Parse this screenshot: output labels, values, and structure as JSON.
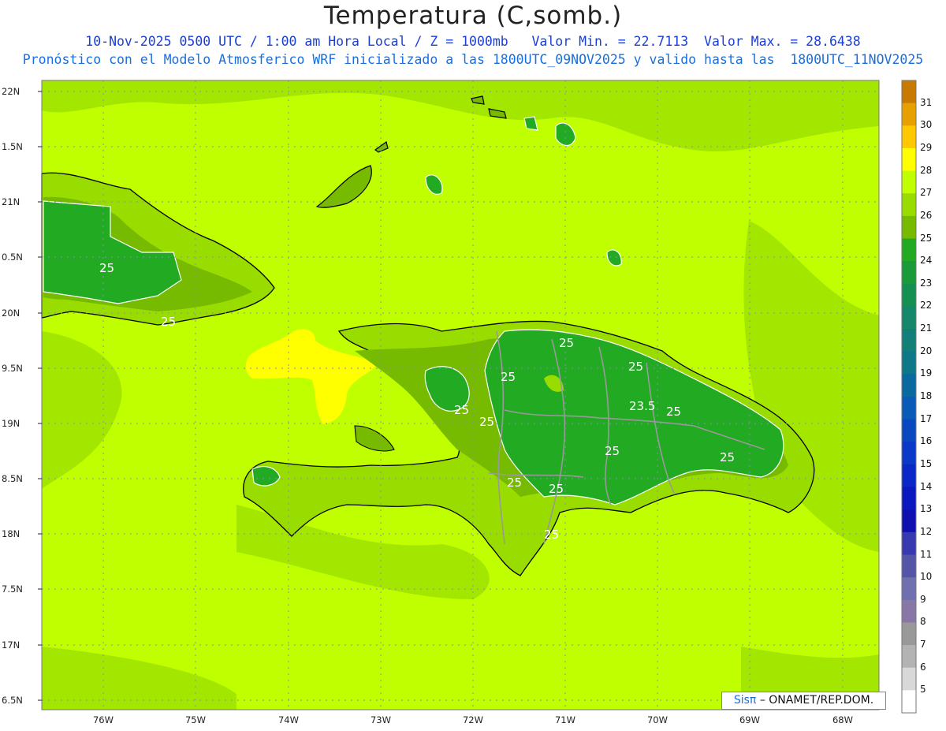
{
  "title": "Temperatura (C,somb.)",
  "subtitle_line1": "10-Nov-2025 0500 UTC / 1:00 am Hora Local / Z = 1000mb   Valor Min. = 22.7113  Valor Max. = 28.6438",
  "subtitle_line2": "Pronóstico con el Modelo Atmosferico WRF inicializado a las 1800UTC_09NOV2025 y valido hasta las  1800UTC_11NOV2025",
  "latitude_labels": [
    "22N",
    "1.5N",
    "21N",
    "0.5N",
    "20N",
    "9.5N",
    "19N",
    "8.5N",
    "18N",
    "7.5N",
    "17N",
    "6.5N"
  ],
  "longitude_labels": [
    "76W",
    "75W",
    "74W",
    "73W",
    "72W",
    "71W",
    "70W",
    "69W",
    "68W"
  ],
  "colorbar": {
    "labels": [
      "31",
      "30",
      "29",
      "28",
      "27",
      "26",
      "25",
      "24",
      "23",
      "22",
      "21",
      "20",
      "19",
      "18",
      "17",
      "16",
      "15",
      "14",
      "13",
      "12",
      "11",
      "10",
      "9",
      "8",
      "7",
      "6",
      "5"
    ],
    "colors": [
      "#c87a00",
      "#e6a000",
      "#ffc800",
      "#ffff00",
      "#bfff00",
      "#99dd00",
      "#77bb00",
      "#22aa22",
      "#1a9a38",
      "#169050",
      "#148868",
      "#108078",
      "#0c7888",
      "#0a6aa0",
      "#0a5ab8",
      "#0a48c0",
      "#0a38c8",
      "#0a28c8",
      "#0a18c0",
      "#1010b0",
      "#3838b0",
      "#5555a8",
      "#7070b0",
      "#8878a8",
      "#999999",
      "#b3b3b3",
      "#d8d8d8",
      "#ffffff"
    ]
  },
  "contour_labels": [
    "25",
    "25",
    "25",
    "25",
    "25",
    "25",
    "25",
    "23.5",
    "25",
    "25",
    "25",
    "25",
    "25",
    "25",
    "25"
  ],
  "credit": {
    "brand": "Sisπ",
    "text": "– ONAMET/REP.DOM."
  },
  "colors": {
    "sea": "#bfff00",
    "land_mid": "#99dd00",
    "land_low": "#77bb00",
    "land_green": "#22aa22",
    "warm": "#ffff00",
    "border": "#999999"
  }
}
